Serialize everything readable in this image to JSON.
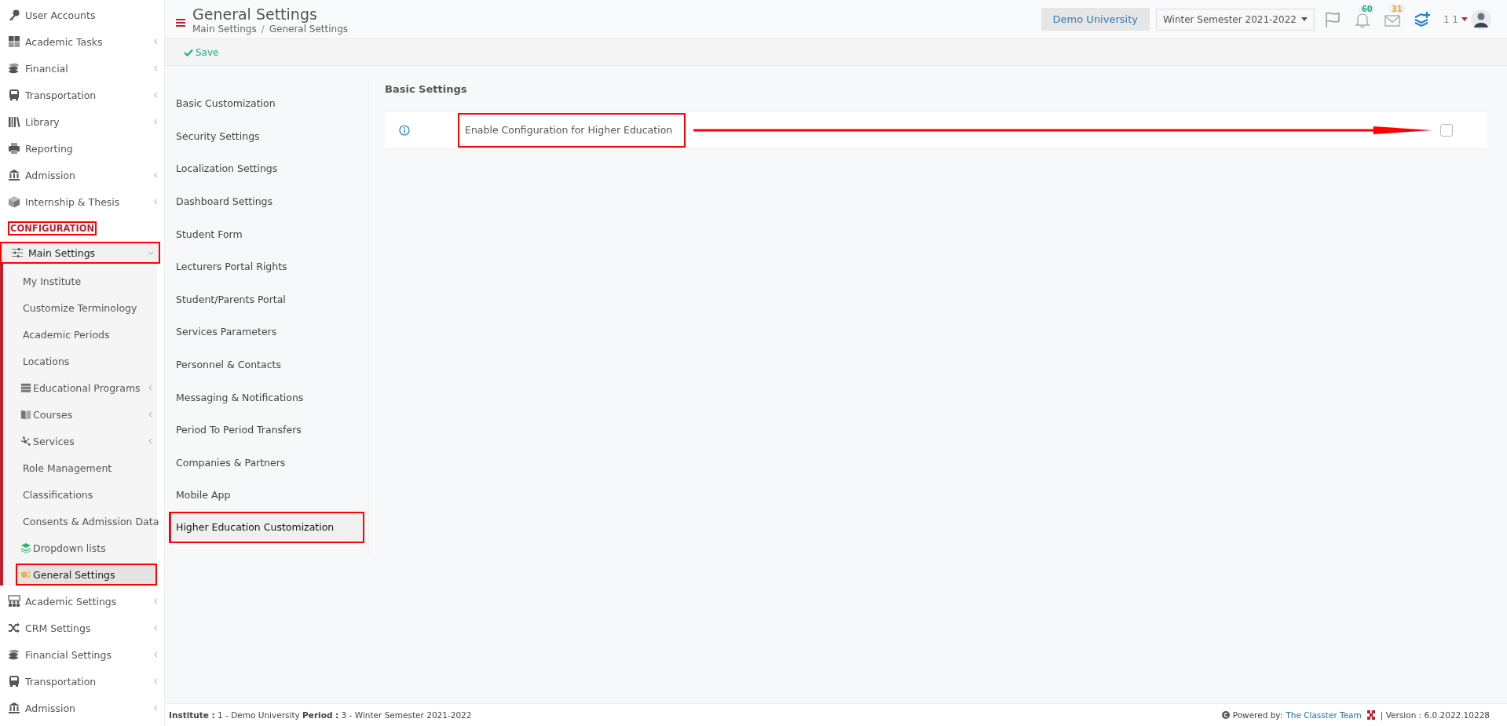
{
  "sidebar": {
    "items": [
      {
        "label": "User Accounts",
        "has_submenu": false
      },
      {
        "label": "Academic Tasks",
        "has_submenu": true
      },
      {
        "label": "Financial",
        "has_submenu": true
      },
      {
        "label": "Transportation",
        "has_submenu": true
      },
      {
        "label": "Library",
        "has_submenu": true
      },
      {
        "label": "Reporting",
        "has_submenu": false
      },
      {
        "label": "Admission",
        "has_submenu": true
      },
      {
        "label": "Internship & Thesis",
        "has_submenu": true
      }
    ],
    "section": {
      "label": "CONFIGURATION",
      "highlighted": true
    },
    "config_items": [
      {
        "label": "Main Settings",
        "has_submenu": true,
        "expanded": true,
        "highlighted": true,
        "children": [
          {
            "label": "My Institute",
            "has_submenu": false,
            "selected": false,
            "highlighted": false
          },
          {
            "label": "Customize Terminology",
            "has_submenu": false,
            "selected": false,
            "highlighted": false
          },
          {
            "label": "Academic Periods",
            "has_submenu": false,
            "selected": false,
            "highlighted": false
          },
          {
            "label": "Locations",
            "has_submenu": false,
            "selected": false,
            "highlighted": false
          },
          {
            "label": "Educational Programs",
            "has_submenu": true,
            "selected": false,
            "highlighted": false
          },
          {
            "label": "Courses",
            "has_submenu": true,
            "selected": false,
            "highlighted": false
          },
          {
            "label": "Services",
            "has_submenu": true,
            "selected": false,
            "highlighted": false
          },
          {
            "label": "Role Management",
            "has_submenu": false,
            "selected": false,
            "highlighted": false
          },
          {
            "label": "Classifications",
            "has_submenu": false,
            "selected": false,
            "highlighted": false
          },
          {
            "label": "Consents & Admission Data",
            "has_submenu": false,
            "selected": false,
            "highlighted": false
          },
          {
            "label": "Dropdown lists",
            "has_submenu": false,
            "selected": false,
            "highlighted": false
          },
          {
            "label": "General Settings",
            "has_submenu": false,
            "selected": true,
            "highlighted": true
          }
        ]
      },
      {
        "label": "Academic Settings",
        "has_submenu": true,
        "expanded": false,
        "highlighted": false
      },
      {
        "label": "CRM Settings",
        "has_submenu": true,
        "expanded": false,
        "highlighted": false
      },
      {
        "label": "Financial Settings",
        "has_submenu": true,
        "expanded": false,
        "highlighted": false
      },
      {
        "label": "Transportation",
        "has_submenu": true,
        "expanded": false,
        "highlighted": false
      },
      {
        "label": "Admission",
        "has_submenu": true,
        "expanded": false,
        "highlighted": false
      }
    ]
  },
  "header": {
    "title": "General Settings",
    "breadcrumb": [
      "Main Settings",
      "General Settings"
    ],
    "breadcrumb_separator": "/",
    "institution": "Demo University",
    "semester": "Winter Semester 2021-2022",
    "notifications_badge": "60",
    "messages_badge": "31",
    "user": "1 1"
  },
  "toolbar": {
    "save": "Save"
  },
  "settings_nav": {
    "items": [
      {
        "label": "Basic Customization",
        "selected": false,
        "highlighted": false
      },
      {
        "label": "Security Settings",
        "selected": false,
        "highlighted": false
      },
      {
        "label": "Localization Settings",
        "selected": false,
        "highlighted": false
      },
      {
        "label": "Dashboard Settings",
        "selected": false,
        "highlighted": false
      },
      {
        "label": "Student Form",
        "selected": false,
        "highlighted": false
      },
      {
        "label": "Lecturers Portal Rights",
        "selected": false,
        "highlighted": false
      },
      {
        "label": "Student/Parents Portal",
        "selected": false,
        "highlighted": false
      },
      {
        "label": "Services Parameters",
        "selected": false,
        "highlighted": false
      },
      {
        "label": "Personnel & Contacts",
        "selected": false,
        "highlighted": false
      },
      {
        "label": "Messaging & Notifications",
        "selected": false,
        "highlighted": false
      },
      {
        "label": "Period To Period Transfers",
        "selected": false,
        "highlighted": false
      },
      {
        "label": "Companies & Partners",
        "selected": false,
        "highlighted": false
      },
      {
        "label": "Mobile App",
        "selected": false,
        "highlighted": false
      },
      {
        "label": "Higher Education Customization",
        "selected": true,
        "highlighted": true
      }
    ]
  },
  "panel": {
    "heading": "Basic Settings",
    "rows": [
      {
        "label": "Enable Configuration for Higher Education",
        "checked": false,
        "highlighted": true
      }
    ]
  },
  "footer": {
    "info": "**Institute :** 1 - Demo University **Period :** 3 - Winter Semester 2021-2022",
    "powered": "Powered by:",
    "team_link": "The Classter Team",
    "version": "| Version : 6.0.2022.10228"
  }
}
